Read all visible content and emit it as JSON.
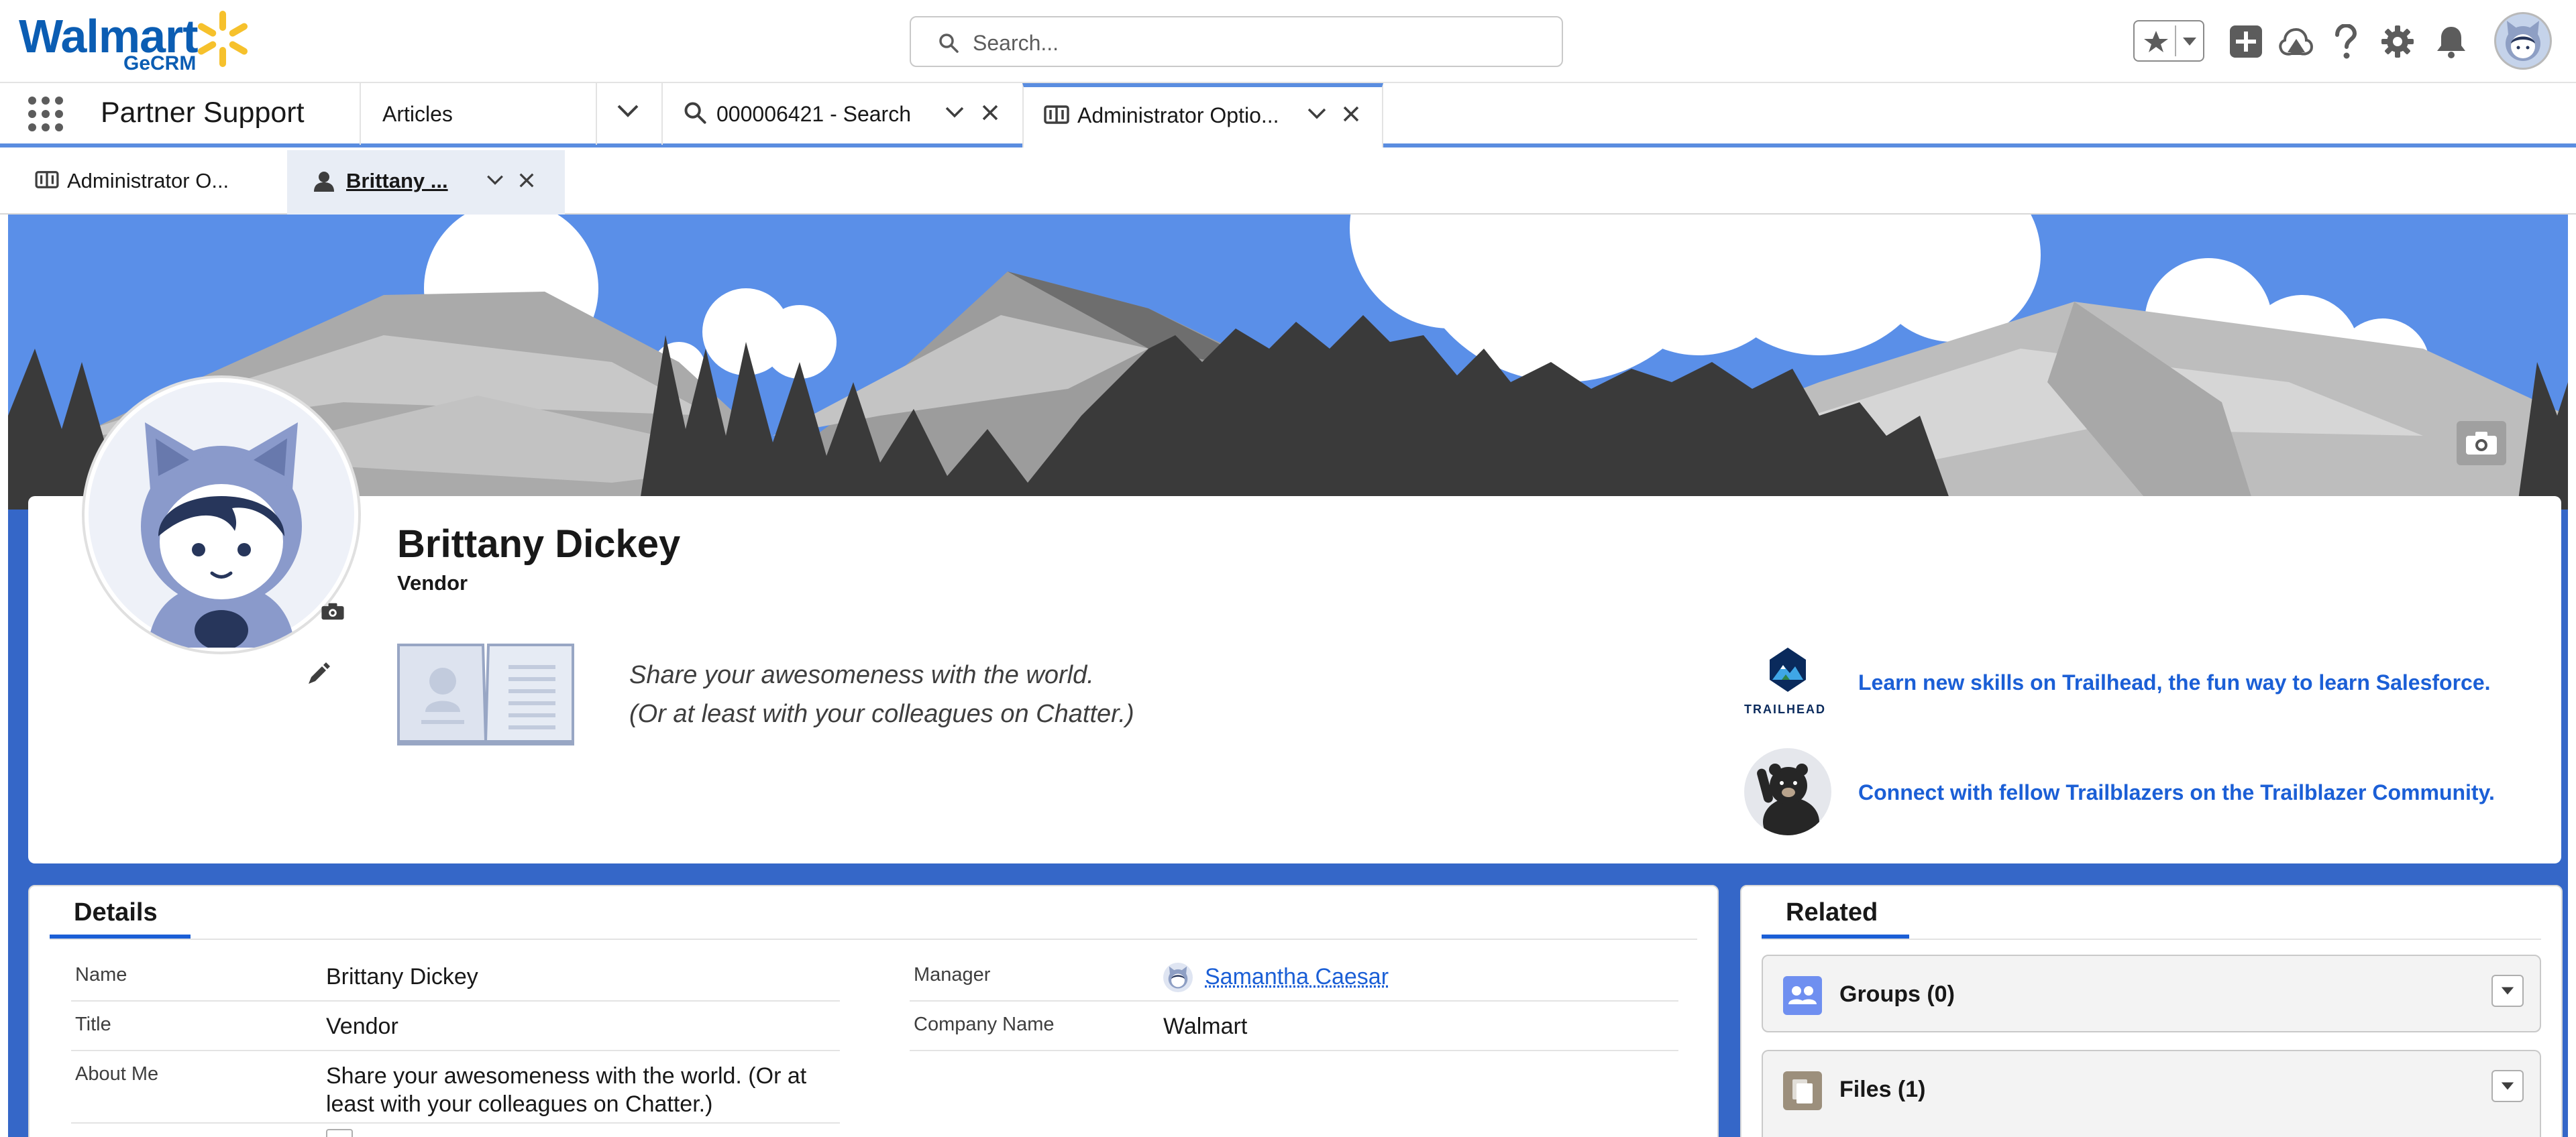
{
  "header": {
    "logo_text": "Walmart",
    "logo_subtext": "GeCRM",
    "search_placeholder": "Search..."
  },
  "nav": {
    "app_name": "Partner Support",
    "object_tab": "Articles",
    "tabs": [
      {
        "label": "000006421 - Search",
        "icon": "search-icon"
      },
      {
        "label": "Administrator Optio...",
        "icon": "knowledge-icon",
        "active": true
      }
    ]
  },
  "subtabs": [
    {
      "label": "Administrator O...",
      "icon": "knowledge-icon"
    },
    {
      "label": "Brittany ...",
      "icon": "user-icon",
      "active": true
    }
  ],
  "profile": {
    "name": "Brittany Dickey",
    "title": "Vendor",
    "about_line1": "Share your awesomeness with the world.",
    "about_line2": "(Or at least with your colleagues on Chatter.)",
    "trailhead_label": "TRAILHEAD",
    "trailhead_link": "Learn new skills on Trailhead, the fun way to learn Salesforce.",
    "community_link": "Connect with fellow Trailblazers on the Trailblazer Community."
  },
  "details": {
    "heading": "Details",
    "left_fields": [
      {
        "label": "Name",
        "value": "Brittany Dickey"
      },
      {
        "label": "Title",
        "value": "Vendor"
      },
      {
        "label": "About Me",
        "value_line1": "Share your awesomeness with the world. (Or at",
        "value_line2": "least with your colleagues on Chatter.)"
      }
    ],
    "right_fields": [
      {
        "label": "Manager",
        "value": "Samantha Caesar"
      },
      {
        "label": "Company Name",
        "value": "Walmart"
      }
    ]
  },
  "related": {
    "heading": "Related",
    "items": [
      {
        "label": "Groups (0)",
        "icon": "groups-icon"
      },
      {
        "label": "Files (1)",
        "icon": "files-icon"
      }
    ]
  },
  "colors": {
    "brand_blue": "#0b5db3",
    "spark_yellow": "#f6c12c",
    "sky": "#5a8fe8",
    "link": "#1b5fd6",
    "page_bg": "#3567c8"
  }
}
